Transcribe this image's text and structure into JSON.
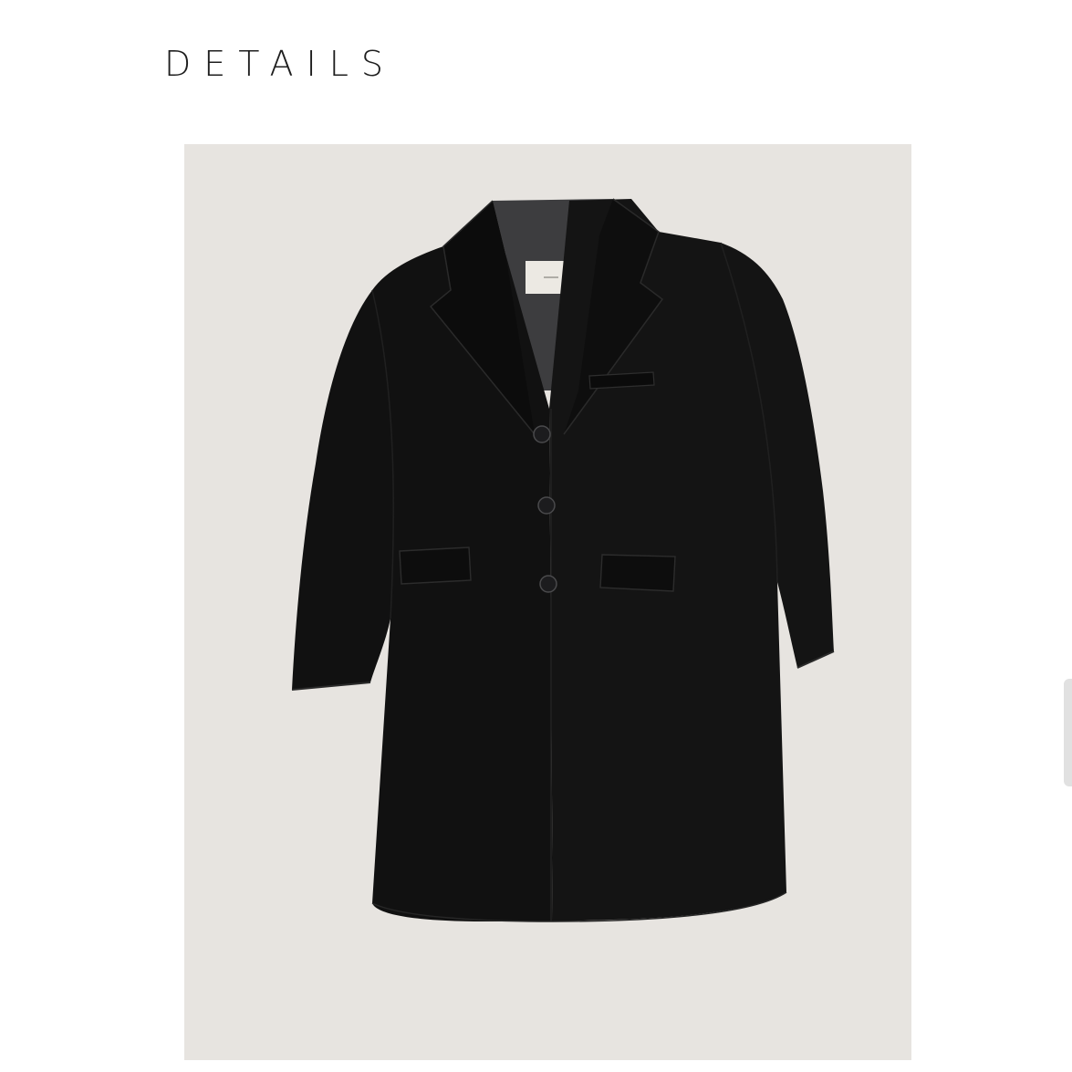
{
  "section": {
    "title": "DETAILS"
  },
  "product_image": {
    "subject": "coat-front-view",
    "background_color": "#e7e4e0",
    "garment_color": "#141414",
    "lining_color": "#3d3d3f",
    "button_count": 3
  },
  "scrollbar": {
    "color": "#e1e1e1"
  }
}
